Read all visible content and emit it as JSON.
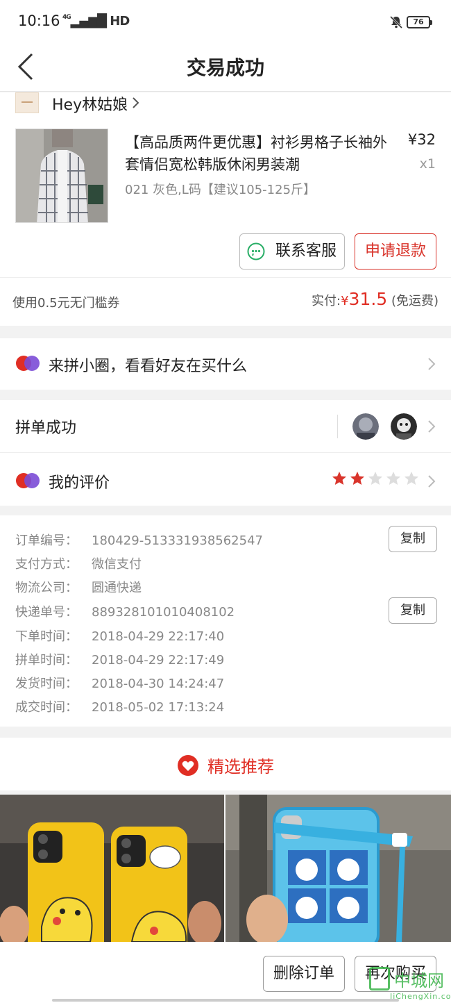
{
  "status_bar": {
    "time": "10:16",
    "network": "HD",
    "network_gen": "4G",
    "battery": "76"
  },
  "nav": {
    "title": "交易成功"
  },
  "store": {
    "name": "Hey林姑娘"
  },
  "product": {
    "title": "【高品质两件更优惠】衬衫男格子长袖外套情侣宽松韩版休闲男装潮",
    "price": "¥32",
    "qty": "x1",
    "spec": "021 灰色,L码【建议105-125斤】",
    "contact_label": "联系客服",
    "refund_label": "申请退款"
  },
  "payment": {
    "coupon_text": "使用0.5元无门槛券",
    "paid_label": "实付:",
    "currency": "¥",
    "paid_amount": "31.5",
    "shipping_note": "(免运费)"
  },
  "circle": {
    "label": "来拼小圈，看看好友在买什么"
  },
  "group": {
    "label": "拼单成功"
  },
  "review": {
    "label": "我的评价",
    "rating": 2,
    "max": 5
  },
  "order_info": {
    "rows": [
      {
        "label": "订单编号：",
        "value": "180429-513331938562547"
      },
      {
        "label": "支付方式：",
        "value": "微信支付"
      },
      {
        "label": "物流公司：",
        "value": "圆通快递"
      },
      {
        "label": "快递单号：",
        "value": "889328101010408102"
      },
      {
        "label": "下单时间：",
        "value": "2018-04-29 22:17:40"
      },
      {
        "label": "拼单时间：",
        "value": "2018-04-29 22:17:49"
      },
      {
        "label": "发货时间：",
        "value": "2018-04-30 14:24:47"
      },
      {
        "label": "成交时间：",
        "value": "2018-05-02 17:13:24"
      }
    ],
    "copy_label": "复制"
  },
  "recommend": {
    "title": "精选推荐"
  },
  "bottom": {
    "delete_label": "删除订单",
    "rebuy_label": "再次购买"
  },
  "watermark": {
    "text": "中城网",
    "sub": "JiChengXin.com"
  },
  "colors": {
    "accent": "#e02e24",
    "wechat": "#2aae67",
    "star_on": "#d9342b",
    "star_off": "#dddddd"
  }
}
